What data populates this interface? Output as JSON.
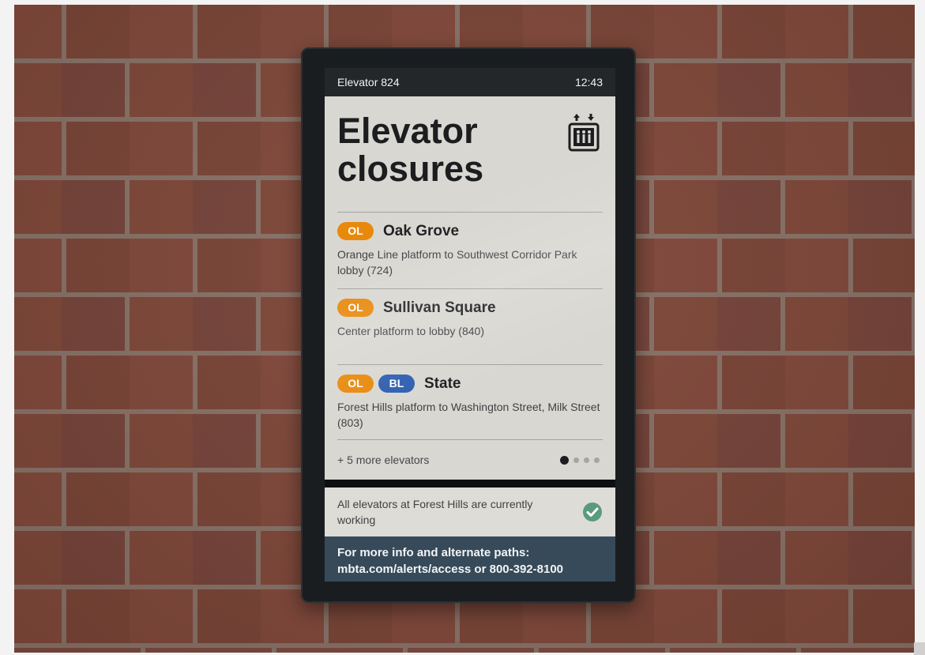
{
  "screen": {
    "elevator_id": "Elevator 824",
    "clock": "12:43",
    "title_line1": "Elevator",
    "title_line2": "closures",
    "icon": "elevator-icon",
    "closures": [
      {
        "badges": [
          "OL"
        ],
        "station": "Oak Grove",
        "description": "Orange Line platform to Southwest Corridor Park lobby (724)"
      },
      {
        "badges": [
          "OL"
        ],
        "station": "Sullivan Square",
        "description": "Center platform to lobby (840)"
      },
      {
        "badges": [
          "OL",
          "BL"
        ],
        "station": "State",
        "description": "Forest Hills platform to Washington Street, Milk Street (803)"
      }
    ],
    "more_label": "+ 5 more elevators",
    "pagination": {
      "pages": 4,
      "current": 1
    },
    "status_message": "All elevators at Forest Hills are currently working",
    "status_icon": "check-circle-icon",
    "info_line1": "For more info and alternate paths:",
    "info_line2": "mbta.com/alerts/access or 800-392-8100"
  },
  "colors": {
    "orange_line": "#e8890c",
    "blue_line": "#2f5fb0",
    "status_bar": "#23272a",
    "info_panel": "#364a5a",
    "check": "#5a9a80"
  }
}
